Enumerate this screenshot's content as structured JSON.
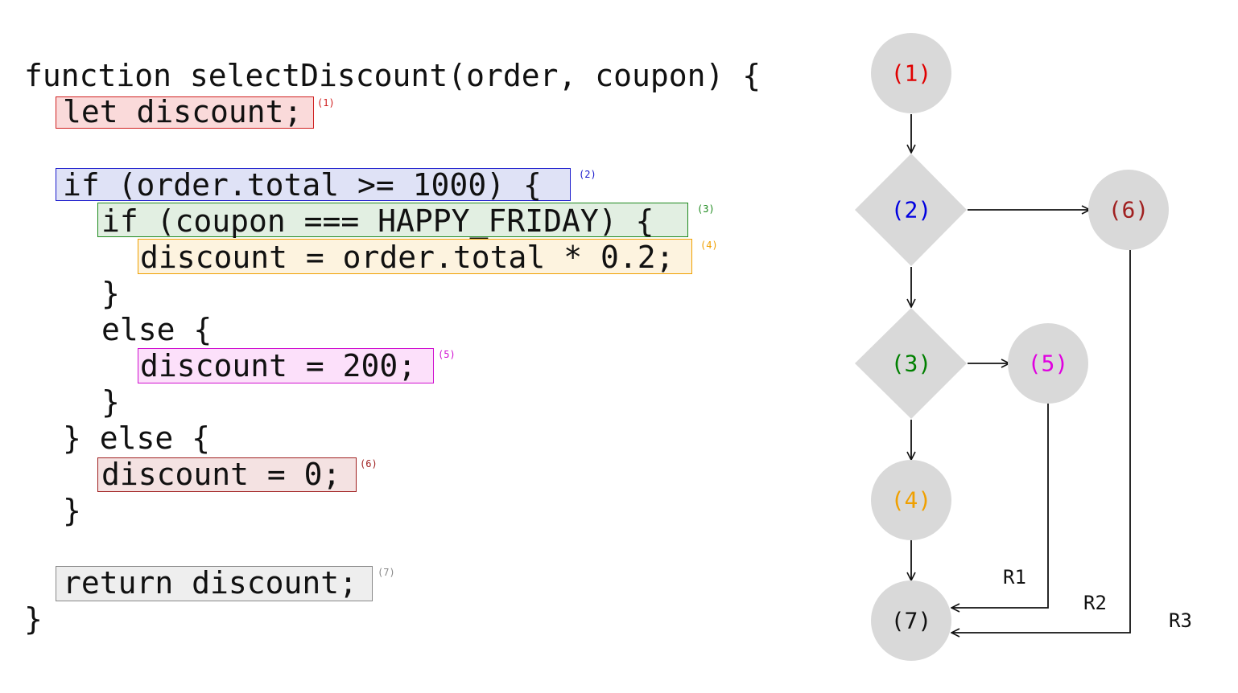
{
  "code": {
    "lines": [
      "function selectDiscount(order, coupon) {",
      "let discount;",
      "if (order.total >= 1000) {",
      "if (coupon === HAPPY_FRIDAY) {",
      "discount = order.total * 0.2;",
      "}",
      "else {",
      "discount = 200;",
      "}",
      "} else {",
      "discount = 0;",
      "}",
      "return discount;",
      "}"
    ],
    "markers": [
      "(1)",
      "(2)",
      "(3)",
      "(4)",
      "(5)",
      "(6)",
      "(7)"
    ]
  },
  "graph": {
    "nodes": [
      {
        "label": "(1)",
        "shape": "circle",
        "color": "#e00000"
      },
      {
        "label": "(2)",
        "shape": "diamond",
        "color": "#0000e0"
      },
      {
        "label": "(3)",
        "shape": "diamond",
        "color": "#008000"
      },
      {
        "label": "(4)",
        "shape": "circle",
        "color": "#f0a000"
      },
      {
        "label": "(5)",
        "shape": "circle",
        "color": "#e000e0"
      },
      {
        "label": "(6)",
        "shape": "circle",
        "color": "#a02020"
      },
      {
        "label": "(7)",
        "shape": "circle",
        "color": "#111111"
      }
    ],
    "regions": [
      "R1",
      "R2",
      "R3"
    ]
  },
  "colors": {
    "node_fill": "#d9d9d9",
    "hl1": {
      "bg": "#fadada",
      "border": "#d02020",
      "marker": "#d02020"
    },
    "hl2": {
      "bg": "#dfe2f6",
      "border": "#1a1acc",
      "marker": "#1a1acc"
    },
    "hl3": {
      "bg": "#e2efe2",
      "border": "#1e8a1e",
      "marker": "#1e8a1e"
    },
    "hl4": {
      "bg": "#fdf3df",
      "border": "#f0a000",
      "marker": "#f0a000"
    },
    "hl5": {
      "bg": "#fce0fa",
      "border": "#d010d0",
      "marker": "#d010d0"
    },
    "hl6": {
      "bg": "#f4e2e2",
      "border": "#a02020",
      "marker": "#a02020"
    },
    "hl7": {
      "bg": "#eeeeee",
      "border": "#888888",
      "marker": "#888888"
    }
  }
}
